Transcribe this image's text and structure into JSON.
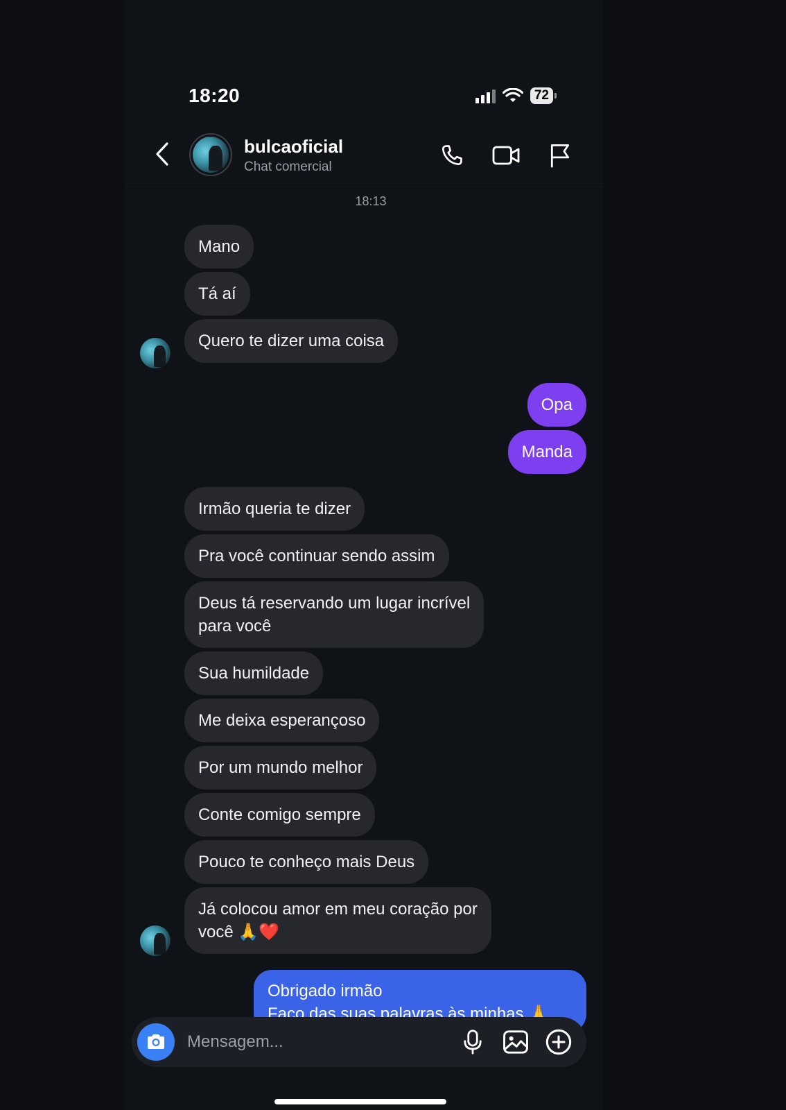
{
  "status_bar": {
    "time": "18:20",
    "battery": "72",
    "icons": [
      "signal-icon",
      "wifi-icon",
      "battery-icon"
    ]
  },
  "header": {
    "contact_name": "bulcaoficial",
    "contact_subtitle": "Chat comercial",
    "icons": [
      "back-chevron-icon",
      "phone-icon",
      "video-camera-icon",
      "flag-icon"
    ]
  },
  "conversation": {
    "timestamp": "18:13",
    "messages": [
      {
        "direction": "in",
        "text": "Mano"
      },
      {
        "direction": "in",
        "text": "Tá aí"
      },
      {
        "direction": "in",
        "text": "Quero te dizer uma coisa"
      },
      {
        "direction": "out",
        "text": "Opa"
      },
      {
        "direction": "out",
        "text": "Manda"
      },
      {
        "direction": "in",
        "text": "Irmão queria te dizer"
      },
      {
        "direction": "in",
        "text": "Pra você continuar sendo assim"
      },
      {
        "direction": "in",
        "line1": "Deus tá reservando um lugar incrível",
        "line2": "para você"
      },
      {
        "direction": "in",
        "text": "Sua humildade"
      },
      {
        "direction": "in",
        "text": "Me deixa esperançoso"
      },
      {
        "direction": "in",
        "text": "Por um mundo melhor"
      },
      {
        "direction": "in",
        "text": "Conte comigo sempre"
      },
      {
        "direction": "in",
        "text": "Pouco te conheço mais Deus"
      },
      {
        "direction": "in",
        "line1": "Já colocou amor em meu coração por",
        "line2": "você 🙏❤️"
      },
      {
        "direction": "out",
        "line1": "Obrigado irmão",
        "line2": "Faço das suas palavras às minhas 🙏"
      }
    ]
  },
  "composer": {
    "placeholder": "Mensagem...",
    "icons": [
      "camera-icon",
      "microphone-icon",
      "gallery-icon",
      "plus-circle-icon"
    ]
  },
  "colors": {
    "incoming_bubble": "#26282d",
    "outgoing_purple": "#7d3ff0",
    "outgoing_blue": "#3a63e8",
    "camera_button": "#3a80f5",
    "background": "#0f1217"
  }
}
